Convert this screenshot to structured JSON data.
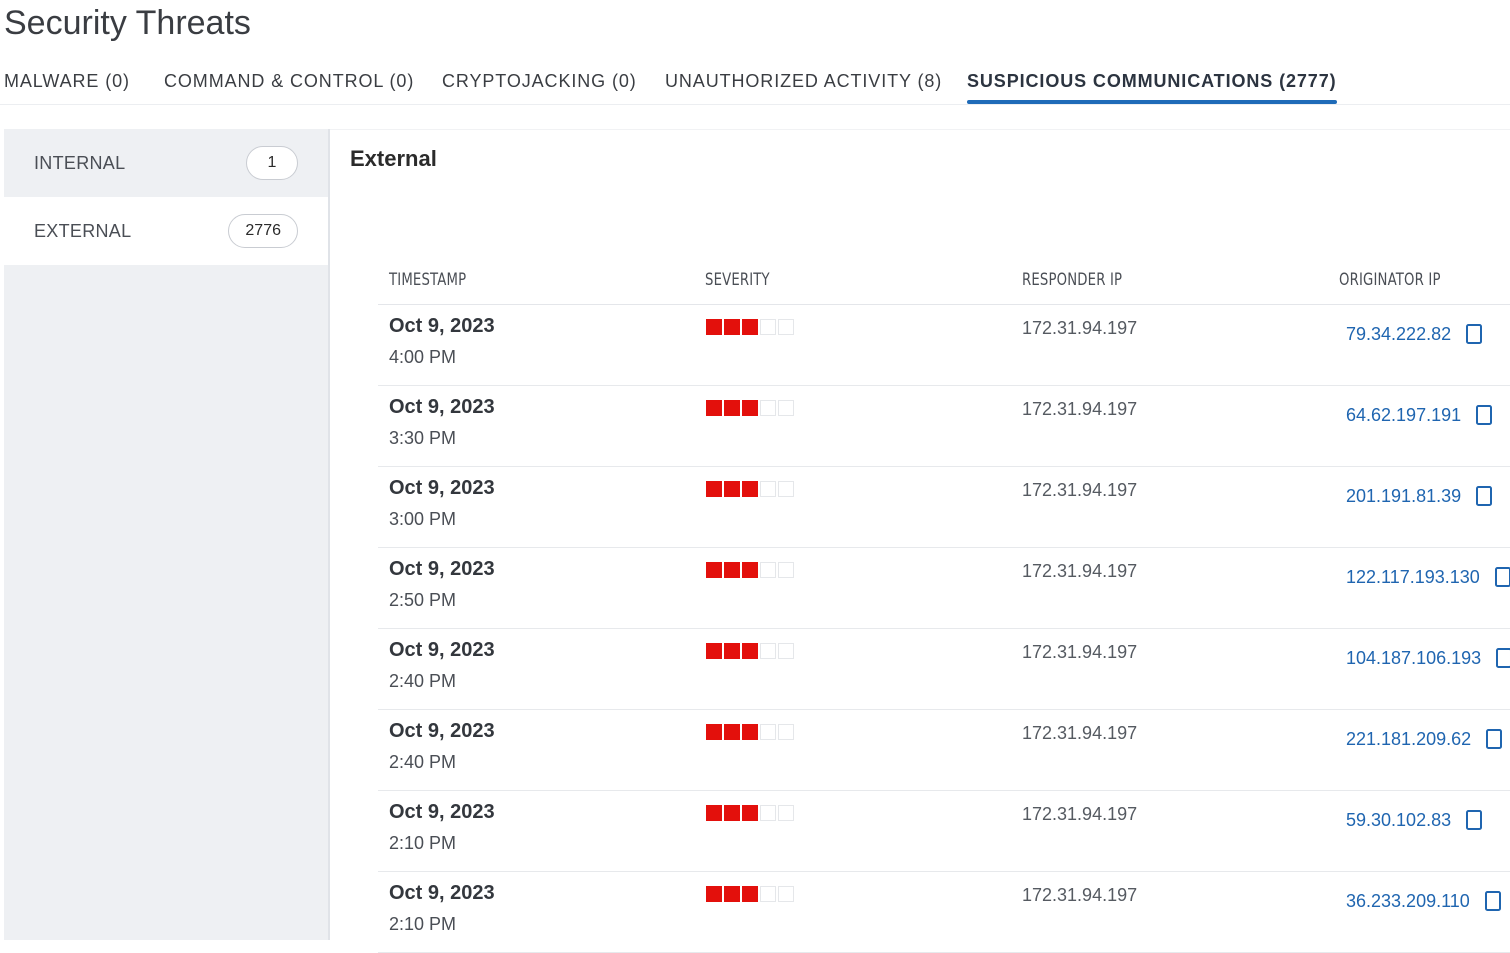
{
  "page": {
    "title": "Security Threats"
  },
  "tabs": [
    {
      "label": "MALWARE (0)"
    },
    {
      "label": "COMMAND & CONTROL (0)"
    },
    {
      "label": "CRYPTOJACKING (0)"
    },
    {
      "label": "UNAUTHORIZED ACTIVITY (8)"
    },
    {
      "label": "SUSPICIOUS COMMUNICATIONS (2777)",
      "active": true
    }
  ],
  "sidebar": {
    "items": [
      {
        "label": "INTERNAL",
        "count": "1"
      },
      {
        "label": "EXTERNAL",
        "count": "2776",
        "selected": true
      }
    ]
  },
  "main": {
    "section_title": "External",
    "columns": [
      "TIMESTAMP",
      "SEVERITY",
      "RESPONDER IP",
      "ORIGINATOR IP"
    ],
    "severity_max": 5,
    "severity_color": "#e3100c",
    "link_color": "#1f65b0",
    "accent_color": "#1f6bb8",
    "rows": [
      {
        "date": "Oct 9, 2023",
        "time": "4:00 PM",
        "severity": 3,
        "responder_ip": "172.31.94.197",
        "originator_ip": "79.34.222.82",
        "icon": "copy-icon"
      },
      {
        "date": "Oct 9, 2023",
        "time": "3:30 PM",
        "severity": 3,
        "responder_ip": "172.31.94.197",
        "originator_ip": "64.62.197.191",
        "icon": "copy-icon"
      },
      {
        "date": "Oct 9, 2023",
        "time": "3:00 PM",
        "severity": 3,
        "responder_ip": "172.31.94.197",
        "originator_ip": "201.191.81.39",
        "icon": "copy-icon"
      },
      {
        "date": "Oct 9, 2023",
        "time": "2:50 PM",
        "severity": 3,
        "responder_ip": "172.31.94.197",
        "originator_ip": "122.117.193.130",
        "icon": "copy-icon"
      },
      {
        "date": "Oct 9, 2023",
        "time": "2:40 PM",
        "severity": 3,
        "responder_ip": "172.31.94.197",
        "originator_ip": "104.187.106.193",
        "icon": "copy-icon"
      },
      {
        "date": "Oct 9, 2023",
        "time": "2:40 PM",
        "severity": 3,
        "responder_ip": "172.31.94.197",
        "originator_ip": "221.181.209.62",
        "icon": "copy-icon"
      },
      {
        "date": "Oct 9, 2023",
        "time": "2:10 PM",
        "severity": 3,
        "responder_ip": "172.31.94.197",
        "originator_ip": "59.30.102.83",
        "icon": "copy-icon"
      },
      {
        "date": "Oct 9, 2023",
        "time": "2:10 PM",
        "severity": 3,
        "responder_ip": "172.31.94.197",
        "originator_ip": "36.233.209.110",
        "icon": "copy-icon"
      }
    ]
  }
}
